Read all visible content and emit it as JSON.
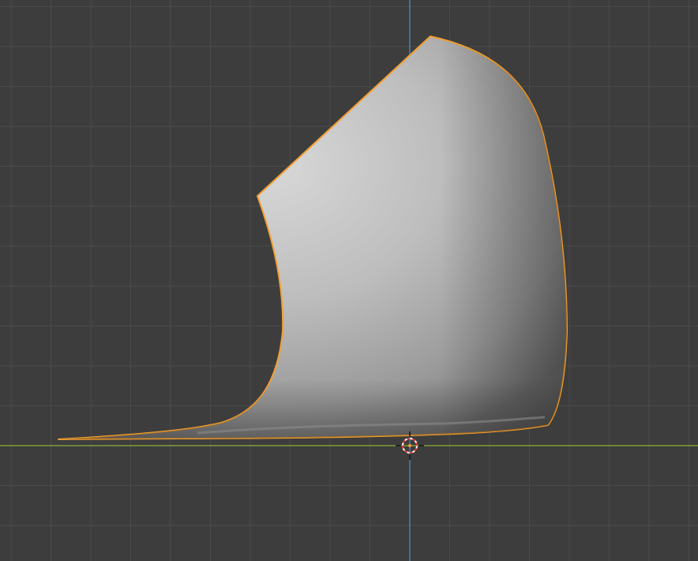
{
  "viewport": {
    "view": "3D Viewport",
    "colors": {
      "background": "#3d3d3d",
      "grid_line": "#4a4a4a",
      "x_axis": "#7f9c3a",
      "z_axis": "#4a7fb0",
      "selection_outline": "#f2a033",
      "mesh_light": "#d6d6d6",
      "mesh_shadow": "#6e6e6e"
    },
    "selected_object": {
      "kind": "mesh",
      "selected": true
    },
    "cursor": {
      "icon": "3d-cursor-icon"
    }
  }
}
